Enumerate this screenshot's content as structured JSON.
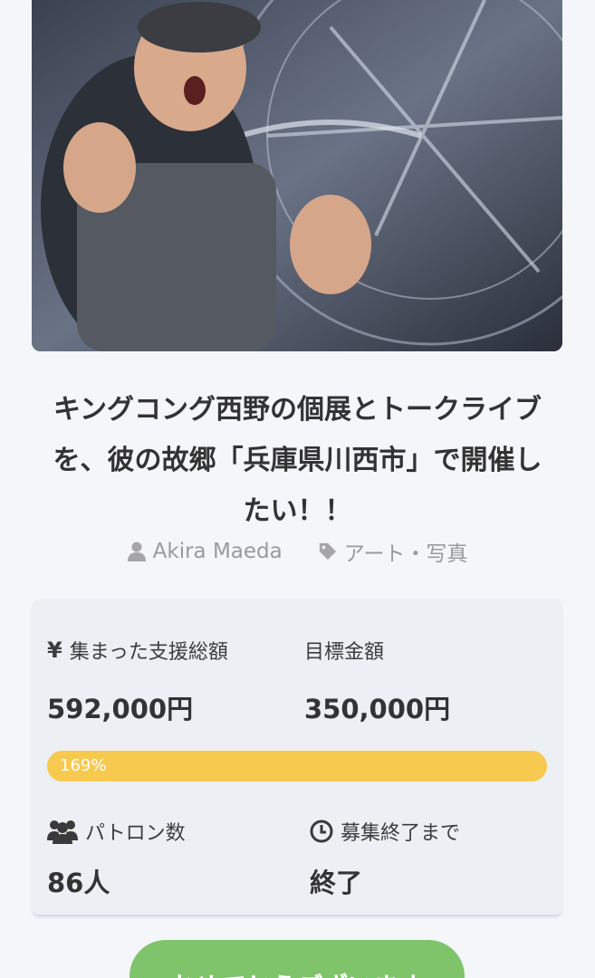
{
  "project": {
    "title_line1": "キングコング西野の個展とトークライブ",
    "title_line2": "を、彼の故郷「兵庫県川西市」で開催し",
    "title_line3": "たい！！",
    "author": "Akira Maeda",
    "category": "アート・写真"
  },
  "stats": {
    "raised_label": "集まった支援総額",
    "raised_value": "592,000円",
    "goal_label": "目標金額",
    "goal_value": "350,000円",
    "progress_text": "169%",
    "progress_fraction": 1.0,
    "patrons_label": "パトロン数",
    "patrons_value": "86人",
    "deadline_label": "募集終了まで",
    "deadline_value": "終了"
  },
  "cta": {
    "label": "おめでとうございます"
  },
  "icons": {
    "author": "user-icon",
    "category": "tag-icon",
    "raised": "yen-icon",
    "patrons": "users-icon",
    "deadline": "clock-icon"
  },
  "colors": {
    "progress": "#f8c94f",
    "cta": "#7fc46a",
    "meta_text": "#9a9a9a"
  }
}
